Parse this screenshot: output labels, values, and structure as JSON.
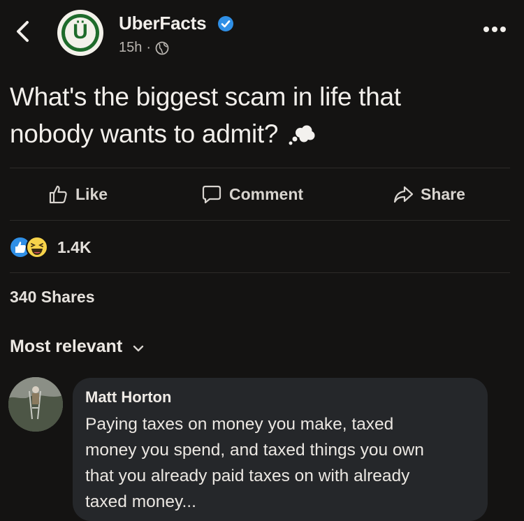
{
  "header": {
    "page_name": "UberFacts",
    "avatar_letter": "Ü",
    "timestamp": "15h",
    "separator": "·",
    "back_icon": "chevron-left-icon",
    "verified_icon": "verified-badge-icon",
    "privacy_icon": "globe-icon",
    "more_icon": "more-horizontal-icon"
  },
  "post": {
    "text_line1": "What's the biggest scam in life that",
    "text_line2": "nobody wants to admit?",
    "emoji": "thought-balloon-icon"
  },
  "actions": {
    "like_label": "Like",
    "comment_label": "Comment",
    "share_label": "Share"
  },
  "reactions": {
    "icons": [
      "like-reaction-icon",
      "haha-reaction-icon"
    ],
    "count": "1.4K"
  },
  "shares_label": "340 Shares",
  "comments_sort": {
    "label": "Most relevant"
  },
  "comments": [
    {
      "author": "Matt Horton",
      "text_lines": [
        "Paying taxes on money you make, taxed",
        "money you spend, and taxed things you own",
        "that you already paid taxes on with already",
        "taxed money..."
      ]
    }
  ],
  "colors": {
    "background": "#141312",
    "bubble": "#25272a",
    "brand_green": "#1e6b2b",
    "verified_blue": "#2f8fe6"
  }
}
